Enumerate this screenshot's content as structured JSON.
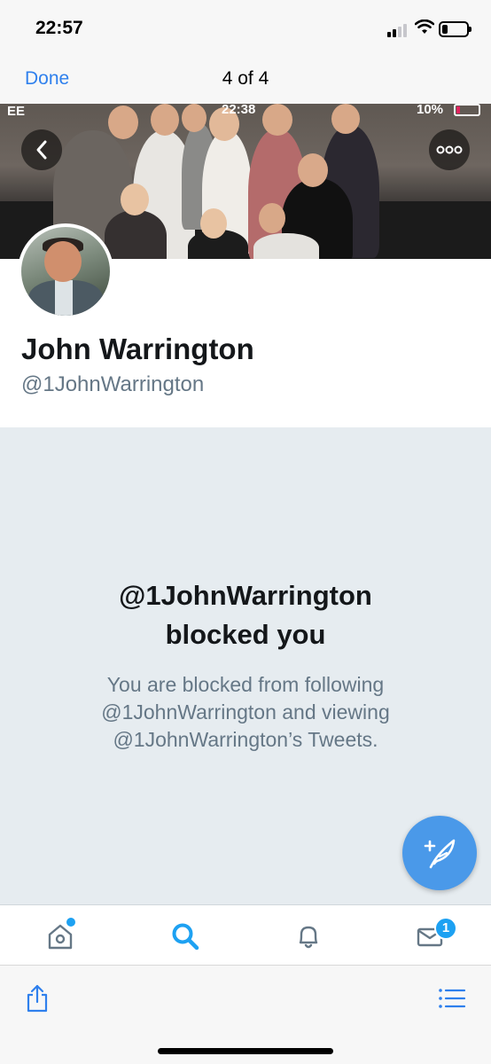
{
  "status_bar": {
    "time": "22:57"
  },
  "nav": {
    "done_label": "Done",
    "counter": "4 of 4"
  },
  "inner_screenshot_status": {
    "carrier": "EE",
    "time": "22:38",
    "battery": "10%"
  },
  "profile": {
    "name": "John Warrington",
    "handle": "@1JohnWarrington"
  },
  "blocked": {
    "title_line1": "@1JohnWarrington",
    "title_line2": "blocked you",
    "description": "You are blocked from following @1JohnWarrington and viewing @1JohnWarrington’s Tweets."
  },
  "tabs": {
    "items": [
      {
        "icon": "home-icon",
        "has_dot": true
      },
      {
        "icon": "search-icon",
        "active": true
      },
      {
        "icon": "bell-icon"
      },
      {
        "icon": "envelope-icon",
        "badge": "1"
      }
    ]
  },
  "toolbar": {
    "left_icon": "share-icon",
    "right_icon": "list-icon"
  },
  "colors": {
    "accent": "#1da1f2",
    "link_blue": "#2f80ed",
    "muted": "#657786",
    "blocked_bg": "#e6ecf0"
  }
}
